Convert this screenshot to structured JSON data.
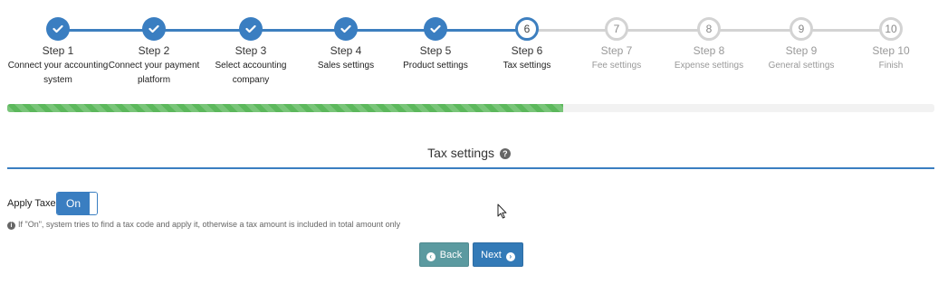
{
  "wizard": {
    "steps": [
      {
        "title": "Step 1",
        "desc": "Connect your accounting system",
        "number": "",
        "state": "done"
      },
      {
        "title": "Step 2",
        "desc": "Connect your payment platform",
        "number": "",
        "state": "done"
      },
      {
        "title": "Step 3",
        "desc": "Select accounting company",
        "number": "",
        "state": "done"
      },
      {
        "title": "Step 4",
        "desc": "Sales settings",
        "number": "",
        "state": "done"
      },
      {
        "title": "Step 5",
        "desc": "Product settings",
        "number": "",
        "state": "done"
      },
      {
        "title": "Step 6",
        "desc": "Tax settings",
        "number": "6",
        "state": "active"
      },
      {
        "title": "Step 7",
        "desc": "Fee settings",
        "number": "7",
        "state": "todo"
      },
      {
        "title": "Step 8",
        "desc": "Expense settings",
        "number": "8",
        "state": "todo"
      },
      {
        "title": "Step 9",
        "desc": "General settings",
        "number": "9",
        "state": "todo"
      },
      {
        "title": "Step 10",
        "desc": "Finish",
        "number": "10",
        "state": "todo"
      }
    ],
    "progress_percent": 60
  },
  "section": {
    "title": "Tax settings",
    "help_icon": "question-circle-icon"
  },
  "apply_taxes": {
    "label": "Apply Taxes",
    "toggle_label": "On",
    "note": "If \"On\", system tries to find a tax code and apply it, otherwise a tax amount is included in total amount only"
  },
  "buttons": {
    "back_label": "Back",
    "next_label": "Next"
  },
  "colors": {
    "primary": "#337ab7",
    "success": "#5cb85c",
    "back_button": "#5b9aa0",
    "inactive": "#d3d3d3"
  }
}
